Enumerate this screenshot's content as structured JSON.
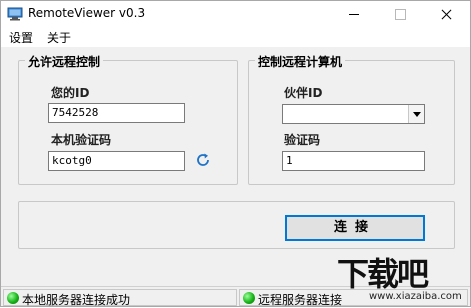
{
  "window": {
    "title": "RemoteViewer v0.3"
  },
  "menu": {
    "settings": "设置",
    "about": "关于"
  },
  "allow_panel": {
    "title": "允许远程控制",
    "your_id_label": "您的ID",
    "your_id_value": "7542528",
    "password_label": "本机验证码",
    "password_value": "kcotg0",
    "refresh_icon": "refresh-icon"
  },
  "control_panel": {
    "title": "控制远程计算机",
    "partner_id_label": "伙伴ID",
    "partner_id_value": "",
    "verify_label": "验证码",
    "verify_value": "1"
  },
  "actions": {
    "connect_label": "连接"
  },
  "status": {
    "local": "本地服务器连接成功",
    "remote": "远程服务器连接",
    "local_color": "#18b418",
    "remote_color": "#18b418"
  },
  "watermark": {
    "brand": "下载吧",
    "url": "www.xiazaiba.com"
  },
  "colors": {
    "accent": "#0078d7",
    "window_bg": "#f0f0f0",
    "refresh_icon": "#1e73c8"
  }
}
